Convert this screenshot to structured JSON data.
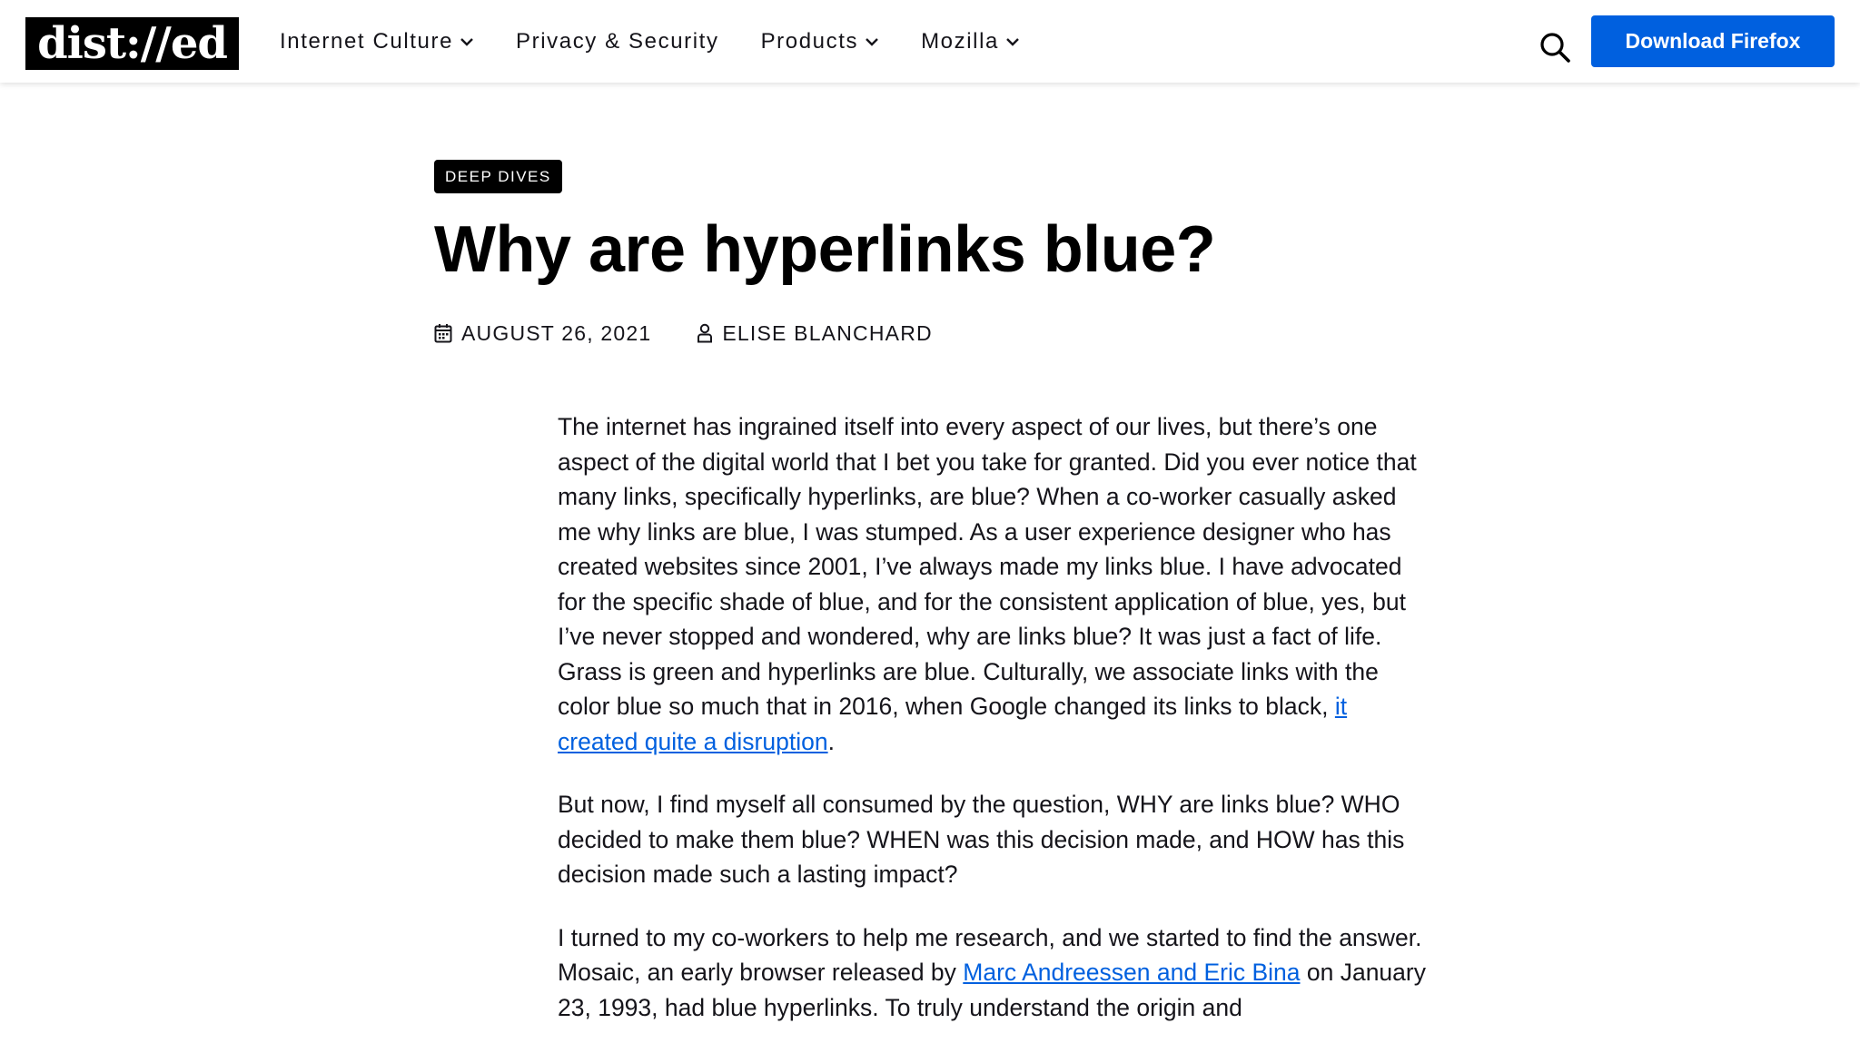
{
  "header": {
    "logo": "dist://ed",
    "nav": [
      {
        "label": "Internet Culture",
        "has_dropdown": true
      },
      {
        "label": "Privacy & Security",
        "has_dropdown": false
      },
      {
        "label": "Products",
        "has_dropdown": true
      },
      {
        "label": "Mozilla",
        "has_dropdown": true
      }
    ],
    "search_icon": "search-icon",
    "download_label": "Download Firefox"
  },
  "article": {
    "tag": "DEEP DIVES",
    "title": "Why are hyperlinks blue?",
    "date": "AUGUST 26, 2021",
    "author": "ELISE BLANCHARD",
    "date_icon": "calendar-icon",
    "author_icon": "user-icon",
    "paragraphs": [
      {
        "before": "The internet has ingrained itself into every aspect of our lives, but there’s one aspect of the digital world that I bet you take for granted. Did you ever notice that many links, specifically hyperlinks, are blue? When a co-worker casually asked me why links are blue, I was stumped. As a user experience designer who has created websites since 2001, I’ve always made my links blue. I have advocated for the specific shade of blue, and for the consistent application of blue, yes, but I’ve never stopped and wondered, why are links blue? It was just a fact of life. Grass is green and hyperlinks are blue. Culturally, we associate links with the color blue so much that in 2016, when Google changed its links to black, ",
        "link": "it created quite a disruption",
        "after": "."
      },
      {
        "text": "But now, I find myself all consumed by the question, WHY are links blue? WHO decided to make them blue? WHEN was this decision made, and HOW has this decision made such a lasting impact?"
      },
      {
        "before": "I turned to my co-workers to help me research, and we started to find the answer. Mosaic, an early browser released by ",
        "link": "Marc Andreessen and Eric Bina",
        "after": " on January 23, 1993, had blue hyperlinks. To truly understand the origin and"
      }
    ]
  },
  "colors": {
    "accent": "#0060df",
    "text": "#15141a",
    "tag_bg": "#000000"
  }
}
